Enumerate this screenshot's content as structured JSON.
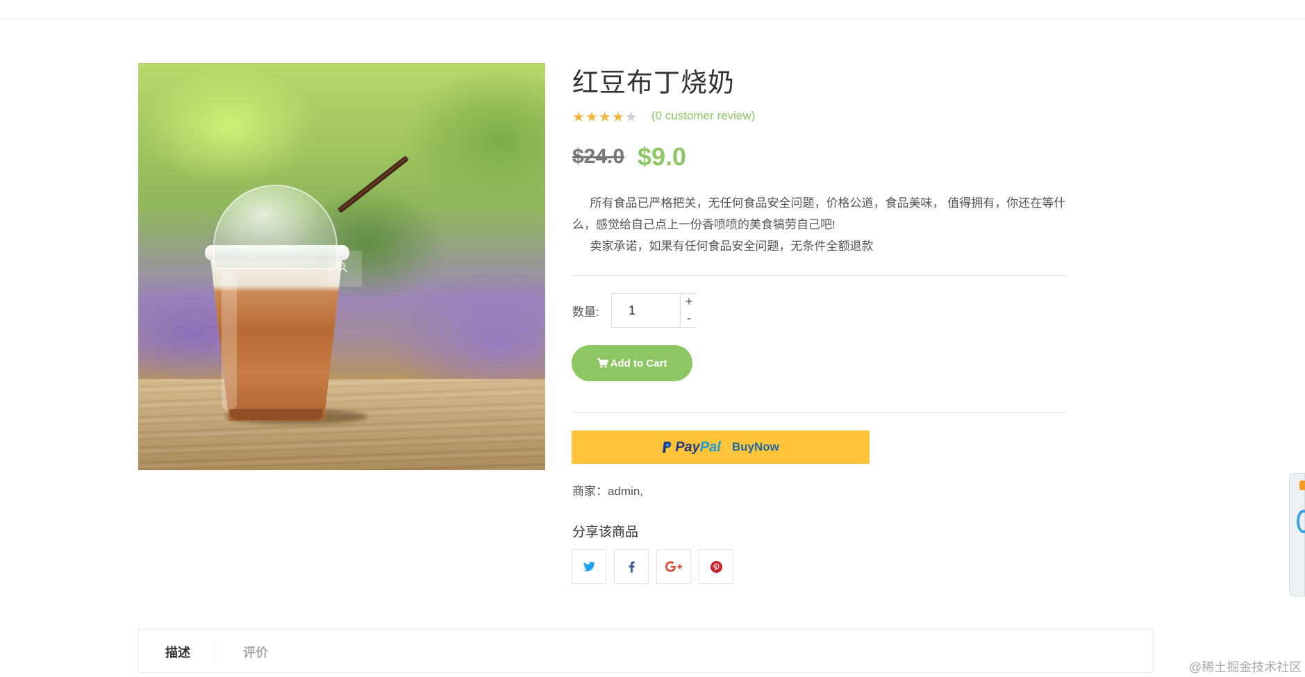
{
  "product": {
    "title": "红豆布丁烧奶",
    "rating_value": 4,
    "rating_max": 5,
    "reviews_text": "(0 customer review)",
    "old_price": "$24.0",
    "new_price": "$9.0",
    "description_line1": "所有食品已严格把关，无任何食品安全问题，价格公道，食品美味， 值得拥有，你还在等什么，感觉给自己点上一份香喷喷的美食犒劳自己吧!",
    "description_line2": "卖家承诺，如果有任何食品安全问题，无条件全额退款"
  },
  "quantity": {
    "label": "数量:",
    "value": "1",
    "plus": "+",
    "minus": "-"
  },
  "cart": {
    "label": "Add to Cart",
    "icon": "shopping-cart-icon"
  },
  "paypal": {
    "brand_pay": "Pay",
    "brand_pal": "Pal",
    "action": "BuyNow"
  },
  "merchant": {
    "text": "商家：admin,"
  },
  "share": {
    "title": "分享该商品",
    "networks": [
      "twitter-icon",
      "facebook-icon",
      "google-plus-icon",
      "pinterest-icon"
    ]
  },
  "tabs": {
    "description": "描述",
    "reviews": "评价"
  },
  "watermark": "@稀土掘金技术社区",
  "colors": {
    "accent_green": "#8dc763",
    "star": "#f2b43b",
    "paypal_yellow": "#ffc43a",
    "twitter": "#1da1f2",
    "facebook": "#3b5998",
    "google_plus": "#dd4b39",
    "pinterest": "#cb2027"
  }
}
